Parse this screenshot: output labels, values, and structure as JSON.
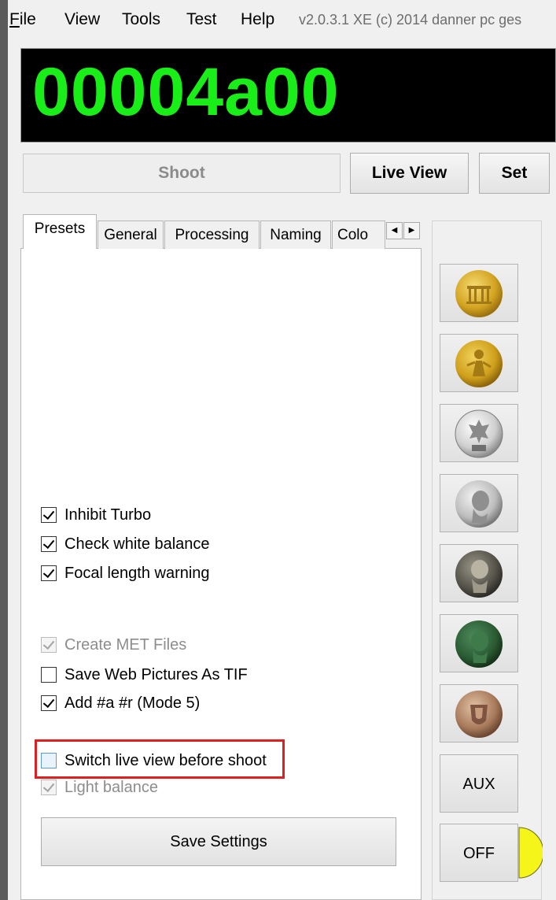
{
  "menu": {
    "items": [
      {
        "mnemonic": "F",
        "rest": "ile"
      },
      {
        "label": "View"
      },
      {
        "label": "Tools"
      },
      {
        "label": "Test"
      },
      {
        "label": "Help"
      }
    ],
    "version": "v2.0.3.1 XE (c) 2014 danner pc ges"
  },
  "counter": {
    "value": "00004a00",
    "color": "#19ee19"
  },
  "buttons": {
    "shoot": "Shoot",
    "live_view": "Live View",
    "set": "Set"
  },
  "tabs": {
    "items": [
      "Presets",
      "General",
      "Processing",
      "Naming",
      "Colo"
    ],
    "active": "Presets",
    "scroll_left": "◀",
    "scroll_right": "▶"
  },
  "options": [
    {
      "label": "Inhibit Turbo",
      "checked": true,
      "enabled": true
    },
    {
      "label": "Check white balance",
      "checked": true,
      "enabled": true
    },
    {
      "label": "Focal length warning",
      "checked": true,
      "enabled": true
    },
    {
      "label": "Create MET Files",
      "checked": true,
      "enabled": false
    },
    {
      "label": "Save Web Pictures As TIF",
      "checked": false,
      "enabled": true
    },
    {
      "label": "Add #a #r (Mode 5)",
      "checked": true,
      "enabled": true
    },
    {
      "label": "Switch live view before shoot",
      "checked": false,
      "enabled": true,
      "highlighted": true
    },
    {
      "label": "Light balance",
      "checked": true,
      "enabled": false
    }
  ],
  "save_settings": "Save Settings",
  "presets": {
    "coins": [
      "gold-gate-coin",
      "gold-figure-coin",
      "silver-eagle-coin",
      "silver-portrait-coin",
      "bronze-portrait-coin",
      "green-portrait-coin",
      "copper-crest-coin"
    ],
    "aux": "AUX",
    "off": "OFF",
    "indicator_color": "#f5f51a"
  }
}
